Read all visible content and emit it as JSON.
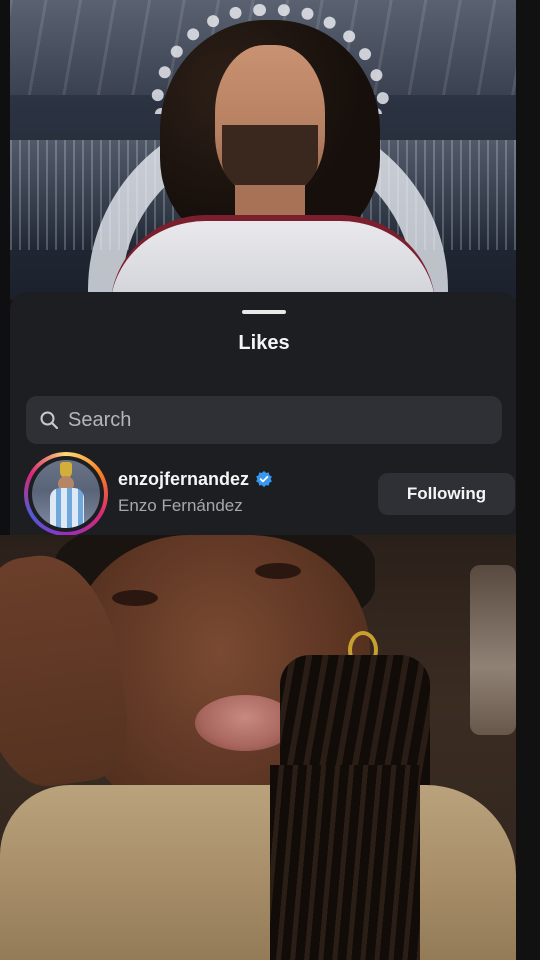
{
  "likes_sheet": {
    "title": "Likes",
    "search": {
      "placeholder": "Search",
      "value": ""
    },
    "users": [
      {
        "username": "enzojfernandez",
        "full_name": "Enzo Fernández",
        "verified": true,
        "follow_button_label": "Following",
        "has_story_ring": true
      }
    ]
  },
  "colors": {
    "sheet_background": "#1c1e22",
    "search_background": "#2e3035",
    "button_background": "#2e3035",
    "verified_badge": "#3897f0",
    "secondary_text": "#a7a8ac"
  },
  "icons": [
    "search-icon",
    "verified-badge-icon"
  ]
}
